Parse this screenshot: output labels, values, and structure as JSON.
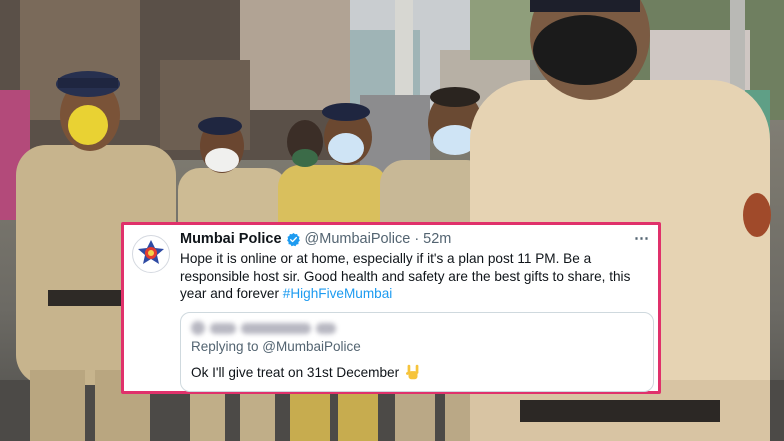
{
  "tweet": {
    "display_name": "Mumbai Police",
    "handle": "@MumbaiPolice",
    "separator": "·",
    "time": "52m",
    "more_icon": "⋯",
    "text_main": "Hope it is online or at home, especially if it's a plan post 11 PM. Be a responsible host sir. Good health and safety are the best gifts to share, this year and forever ",
    "hashtag": "#HighFiveMumbai",
    "verified_icon": "verified-badge-icon",
    "avatar_icon": "mumbai-police-emblem-icon"
  },
  "quoted_reply": {
    "replying_prefix": "Replying to ",
    "replying_handle": "@MumbaiPolice",
    "text": "Ok I'll give treat on 31st December",
    "emoji_icon": "sign-of-the-horns-emoji-icon"
  },
  "colors": {
    "card_border": "#e0316b",
    "hashtag": "#1d9bf0",
    "verified": "#1d9bf0"
  }
}
